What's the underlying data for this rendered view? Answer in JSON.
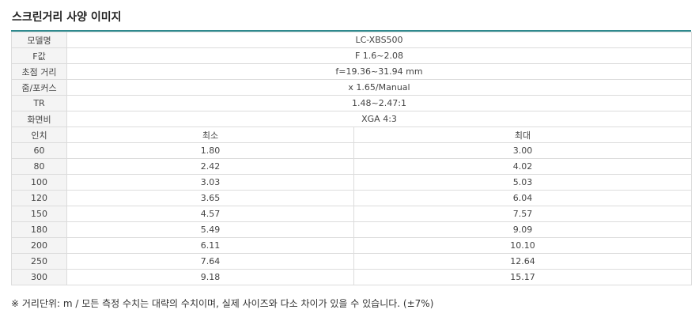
{
  "title": "스크린거리 사양 이미지",
  "specs": [
    {
      "label": "모델명",
      "value": "LC-XBS500"
    },
    {
      "label": "F값",
      "value": "F 1.6~2.08"
    },
    {
      "label": "초점 거리",
      "value": "f=19.36~31.94 mm"
    },
    {
      "label": "줌/포커스",
      "value": "x 1.65/Manual"
    },
    {
      "label": "TR",
      "value": "1.48~2.47:1"
    },
    {
      "label": "화면비",
      "value": "XGA 4:3"
    }
  ],
  "distance_table": {
    "headers": [
      "인치",
      "최소",
      "최대"
    ],
    "rows": [
      [
        "60",
        "1.80",
        "3.00"
      ],
      [
        "80",
        "2.42",
        "4.02"
      ],
      [
        "100",
        "3.03",
        "5.03"
      ],
      [
        "120",
        "3.65",
        "6.04"
      ],
      [
        "150",
        "4.57",
        "7.57"
      ],
      [
        "180",
        "5.49",
        "9.09"
      ],
      [
        "200",
        "6.11",
        "10.10"
      ],
      [
        "250",
        "7.64",
        "12.64"
      ],
      [
        "300",
        "9.18",
        "15.17"
      ]
    ]
  },
  "note": "※ 거리단위: m / 모든 측정 수치는 대략의 수치이며, 실제 사이즈와 다소 차이가 있을 수 있습니다. (±7%)"
}
